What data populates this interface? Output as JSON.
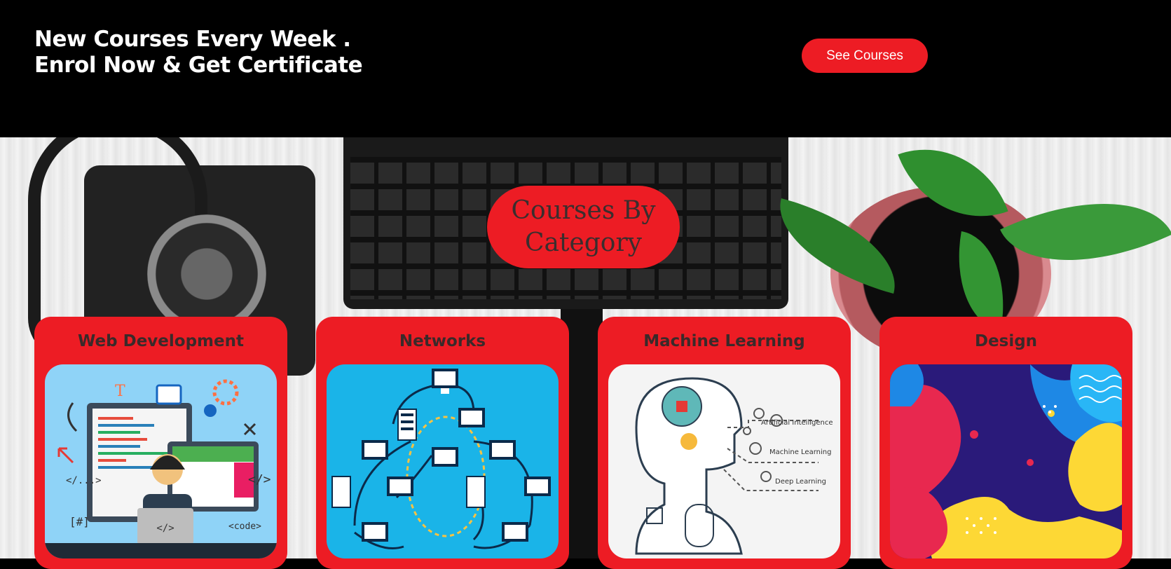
{
  "header": {
    "promo_line1": "New Courses Every Week .",
    "promo_line2": "Enrol Now & Get Certificate",
    "cta_label": "See Courses"
  },
  "section": {
    "title_line1": "Courses By",
    "title_line2": "Category"
  },
  "categories": [
    {
      "title": "Web Development",
      "image": "web-development-illustration"
    },
    {
      "title": "Networks",
      "image": "network-diagram-illustration"
    },
    {
      "title": "Machine Learning",
      "image": "machine-learning-illustration"
    },
    {
      "title": "Design",
      "image": "abstract-design-illustration"
    }
  ],
  "ml_labels": [
    "Artificial Intelligence",
    "Machine Learning",
    "Deep Learning"
  ],
  "web_labels": [
    "</>",
    "<code>",
    "</...>",
    "[#]",
    "</>"
  ],
  "colors": {
    "accent": "#ed1c24",
    "header_bg": "#000000",
    "card_title": "#3a2a2a"
  }
}
